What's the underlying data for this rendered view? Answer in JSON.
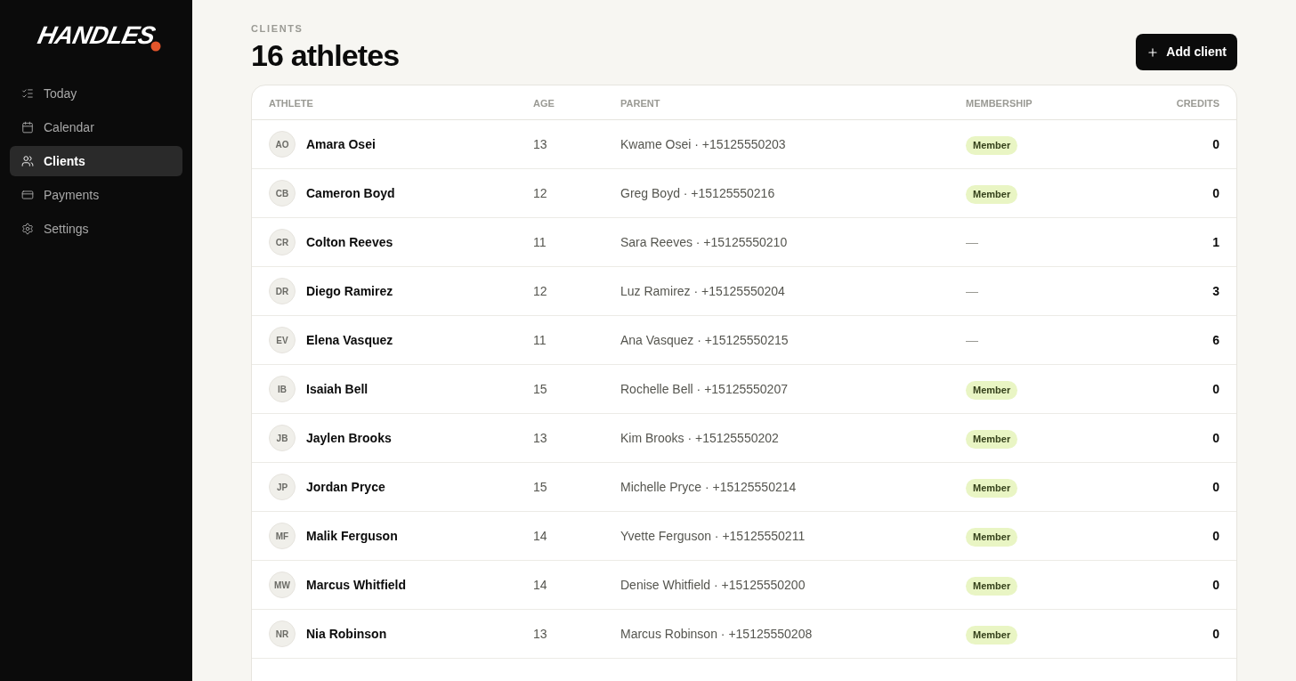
{
  "sidebar": {
    "logo": "HANDLES",
    "items": [
      {
        "label": "Today",
        "selected": false
      },
      {
        "label": "Calendar",
        "selected": false
      },
      {
        "label": "Clients",
        "selected": true
      },
      {
        "label": "Payments",
        "selected": false
      },
      {
        "label": "Settings",
        "selected": false
      }
    ]
  },
  "header": {
    "eyebrow": "CLIENTS",
    "title": "16 athletes",
    "button": "Add client"
  },
  "table": {
    "columns": [
      "ATHLETE",
      "AGE",
      "PARENT",
      "MEMBERSHIP",
      "CREDITS"
    ],
    "rows": [
      {
        "initials": "AO",
        "name": "Amara Osei",
        "age": "13",
        "parent": "Kwame Osei · +15125550203",
        "membership": {
          "kind": "badge",
          "label": "Member"
        },
        "credits": "0"
      },
      {
        "initials": "CB",
        "name": "Cameron Boyd",
        "age": "12",
        "parent": "Greg Boyd · +15125550216",
        "membership": {
          "kind": "badge",
          "label": "Member"
        },
        "credits": "0"
      },
      {
        "initials": "CR",
        "name": "Colton Reeves",
        "age": "11",
        "parent": "Sara Reeves · +15125550210",
        "membership": {
          "kind": "none",
          "label": "—"
        },
        "credits": "1"
      },
      {
        "initials": "DR",
        "name": "Diego Ramirez",
        "age": "12",
        "parent": "Luz Ramirez · +15125550204",
        "membership": {
          "kind": "none",
          "label": "—"
        },
        "credits": "3"
      },
      {
        "initials": "EV",
        "name": "Elena Vasquez",
        "age": "11",
        "parent": "Ana Vasquez · +15125550215",
        "membership": {
          "kind": "none",
          "label": "—"
        },
        "credits": "6"
      },
      {
        "initials": "IB",
        "name": "Isaiah Bell",
        "age": "15",
        "parent": "Rochelle Bell · +15125550207",
        "membership": {
          "kind": "badge",
          "label": "Member"
        },
        "credits": "0"
      },
      {
        "initials": "JB",
        "name": "Jaylen Brooks",
        "age": "13",
        "parent": "Kim Brooks · +15125550202",
        "membership": {
          "kind": "badge",
          "label": "Member"
        },
        "credits": "0"
      },
      {
        "initials": "JP",
        "name": "Jordan Pryce",
        "age": "15",
        "parent": "Michelle Pryce · +15125550214",
        "membership": {
          "kind": "badge",
          "label": "Member"
        },
        "credits": "0"
      },
      {
        "initials": "MF",
        "name": "Malik Ferguson",
        "age": "14",
        "parent": "Yvette Ferguson · +15125550211",
        "membership": {
          "kind": "badge",
          "label": "Member"
        },
        "credits": "0"
      },
      {
        "initials": "MW",
        "name": "Marcus Whitfield",
        "age": "14",
        "parent": "Denise Whitfield · +15125550200",
        "membership": {
          "kind": "badge",
          "label": "Member"
        },
        "credits": "0"
      },
      {
        "initials": "NR",
        "name": "Nia Robinson",
        "age": "13",
        "parent": "Marcus Robinson · +15125550208",
        "membership": {
          "kind": "badge",
          "label": "Member"
        },
        "credits": "0"
      }
    ]
  }
}
